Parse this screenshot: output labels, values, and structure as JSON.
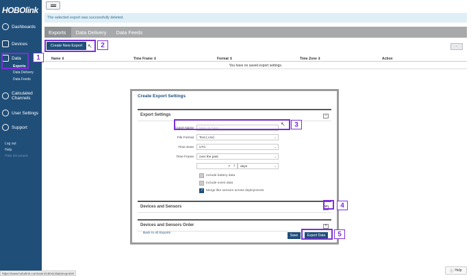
{
  "sidebar": {
    "logo": "HOBOlink",
    "items": [
      {
        "label": "Dashboards",
        "icon": "gauge-icon"
      },
      {
        "label": "Devices",
        "icon": "device-icon"
      },
      {
        "label": "Data",
        "icon": "data-chart-icon"
      },
      {
        "label": "Calculated Channels",
        "icon": "calc-channel-icon"
      },
      {
        "label": "User Settings",
        "icon": "gear-icon"
      },
      {
        "label": "Support",
        "icon": "headset-icon"
      }
    ],
    "data_sub": [
      "Exports",
      "Data Delivery",
      "Data Feeds"
    ],
    "footer_links": [
      "Log out",
      "Help",
      "Hide document"
    ]
  },
  "alert": "The selected export was successfully deleted.",
  "tabs": [
    "Exports",
    "Data Delivery",
    "Data Feeds"
  ],
  "create_button": "Create New Export",
  "table": {
    "columns": [
      "Name",
      "Time Frame",
      "Format",
      "Time Zone",
      "Action"
    ],
    "empty": "You have no saved export settings."
  },
  "modal": {
    "title": "Create Export Settings",
    "export_settings": {
      "heading": "Export Settings",
      "toggle": "−",
      "export_name": {
        "label": "Export Name",
        "placeholder": "Main St Farm"
      },
      "file_format": {
        "label": "File Format",
        "value": "Text (.csv)"
      },
      "time_zone": {
        "label": "Time Zone",
        "value": "UTC"
      },
      "time_frame": {
        "label": "Time Frame",
        "value": "over the past"
      },
      "days": {
        "value": "7",
        "unit": "days"
      },
      "checkboxes": [
        {
          "label": "Include battery data",
          "checked": false
        },
        {
          "label": "Include event data",
          "checked": false
        },
        {
          "label": "Merge like sensors across deployments",
          "checked": true
        }
      ]
    },
    "devices_sensors": {
      "heading": "Devices and Sensors",
      "toggle": "+"
    },
    "devices_order": {
      "heading": "Devices and Sensors Order",
      "toggle": "+"
    },
    "back_link": "Back to All Exports",
    "save": "Save",
    "export_data": "Export Data"
  },
  "annotations": [
    "1",
    "2",
    "3",
    "4",
    "5"
  ],
  "status_url": "https://www.hobolink.com/users/15041/data/exports#",
  "help": "Help",
  "colors": {
    "sidebar": "#1f4e79",
    "highlight": "#7b2fd9",
    "tabs": "#a7a9ab"
  }
}
